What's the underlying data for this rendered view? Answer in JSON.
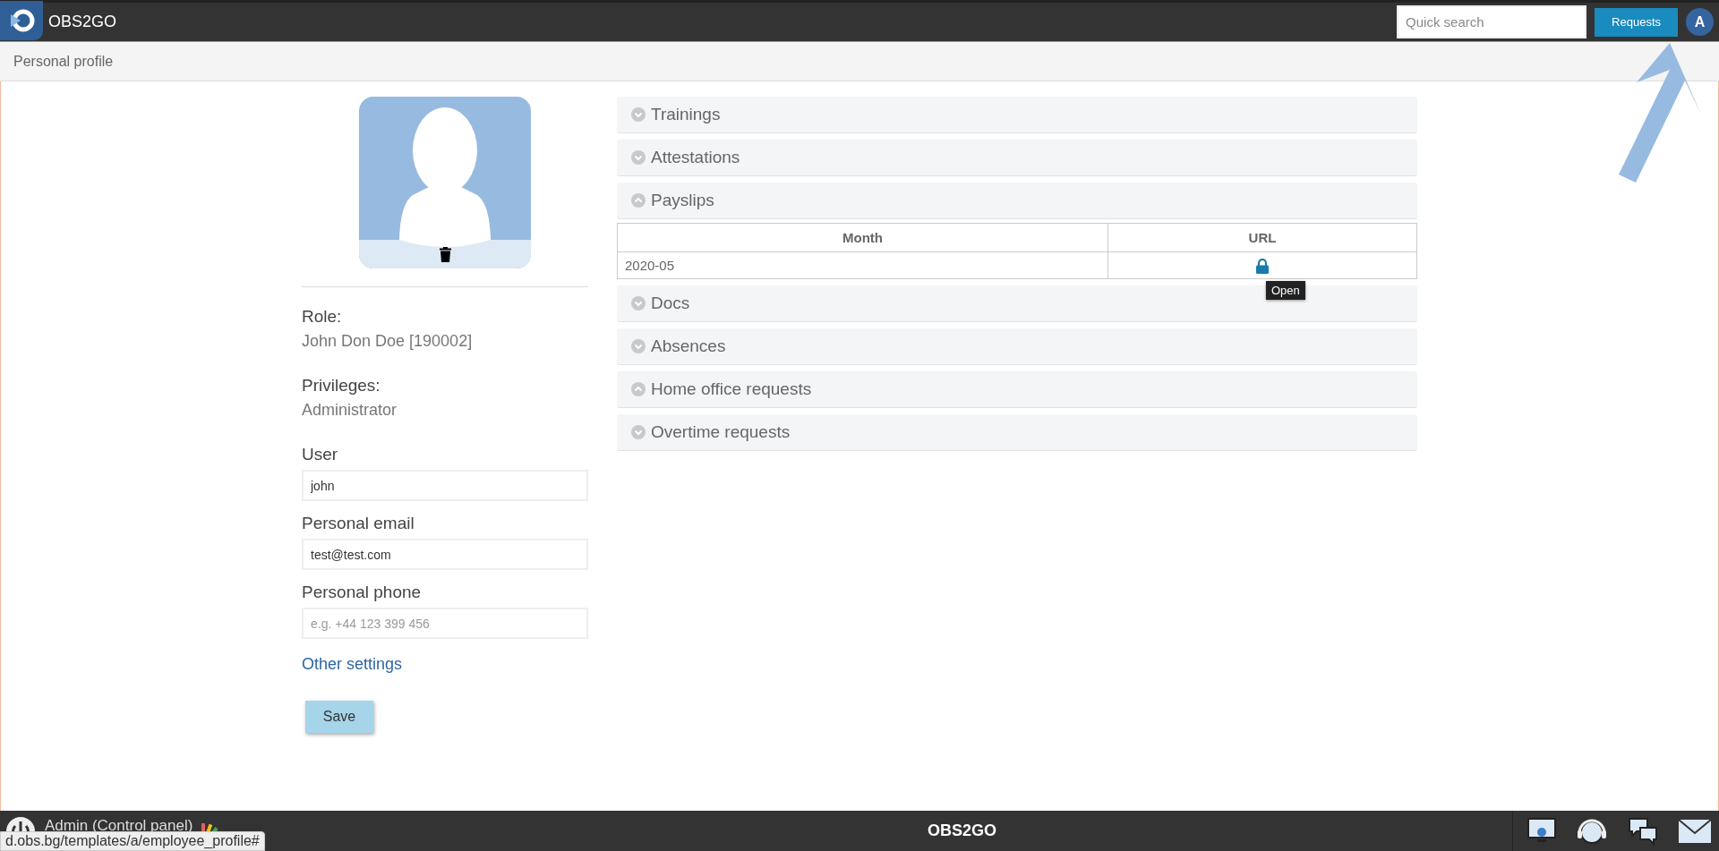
{
  "header": {
    "app_name": "OBS2GO",
    "search": {
      "placeholder": "Quick search"
    },
    "requests_button": "Requests",
    "user_initial": "A"
  },
  "breadcrumb": "Personal profile",
  "profile": {
    "role_label": "Role:",
    "role_value": "John Don Doe [190002]",
    "privileges_label": "Privileges:",
    "privileges_value": "Administrator",
    "fields": [
      {
        "label": "User",
        "value": "john"
      },
      {
        "label": "Personal email",
        "value": "test@test.com"
      },
      {
        "label": "Personal phone",
        "placeholder": "e.g. +44 123 399 456"
      }
    ],
    "link": "Other settings",
    "save_button": "Save"
  },
  "sections": [
    {
      "title": "Trainings",
      "expanded": false
    },
    {
      "title": "Attestations",
      "expanded": false
    },
    {
      "title": "Payslips",
      "expanded": true,
      "table": {
        "columns": [
          "Month",
          "URL"
        ],
        "rows": [
          {
            "month": "2020-05",
            "tooltip": "Open"
          }
        ]
      }
    },
    {
      "title": "Docs",
      "expanded": false
    },
    {
      "title": "Absences",
      "expanded": false
    },
    {
      "title": "Home office requests",
      "expanded": true
    },
    {
      "title": "Overtime requests",
      "expanded": false
    }
  ],
  "footer": {
    "user_label": "Admin (Control panel)",
    "app_name": "OBS2GO"
  },
  "status_url": "d.obs.bg/templates/a/employee_profile#"
}
